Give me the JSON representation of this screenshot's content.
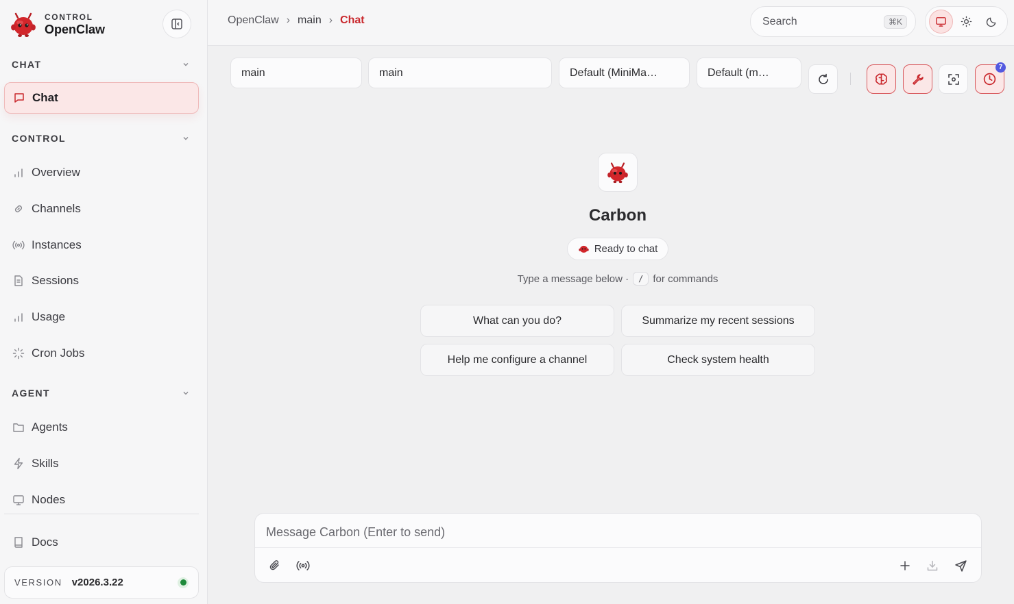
{
  "brand": {
    "eyebrow": "CONTROL",
    "name": "OpenClaw"
  },
  "sidebar": {
    "sections": [
      {
        "label": "CHAT",
        "items": [
          {
            "label": "Chat",
            "icon": "message-icon",
            "active": true
          }
        ]
      },
      {
        "label": "CONTROL",
        "items": [
          {
            "label": "Overview",
            "icon": "bar-chart-icon"
          },
          {
            "label": "Channels",
            "icon": "link-icon"
          },
          {
            "label": "Instances",
            "icon": "broadcast-icon"
          },
          {
            "label": "Sessions",
            "icon": "document-icon"
          },
          {
            "label": "Usage",
            "icon": "bar-chart-icon"
          },
          {
            "label": "Cron Jobs",
            "icon": "loader-icon"
          }
        ]
      },
      {
        "label": "AGENT",
        "items": [
          {
            "label": "Agents",
            "icon": "folder-icon"
          },
          {
            "label": "Skills",
            "icon": "lightning-icon"
          },
          {
            "label": "Nodes",
            "icon": "monitor-icon"
          }
        ]
      }
    ],
    "docs_label": "Docs",
    "version_key": "VERSION",
    "version_value": "v2026.3.22",
    "status_color": "#1f8a3b"
  },
  "breadcrumb": {
    "root": "OpenClaw",
    "middle": "main",
    "current": "Chat",
    "separator": "›"
  },
  "search": {
    "placeholder": "Search",
    "shortcut": "⌘K"
  },
  "theme": {
    "selected": "system",
    "options": [
      "monitor-icon",
      "sun-icon",
      "moon-icon"
    ]
  },
  "toolbar": {
    "selects": [
      "main",
      "main",
      "Default (MiniMa…",
      "Default (m…"
    ],
    "history_badge": "7"
  },
  "welcome": {
    "agent_name": "Carbon",
    "status": "Ready to chat",
    "hint_prefix": "Type a message below ·",
    "hint_key": "/",
    "hint_suffix": "for commands",
    "suggestions": [
      "What can you do?",
      "Summarize my recent sessions",
      "Help me configure a channel",
      "Check system health"
    ]
  },
  "composer": {
    "placeholder": "Message Carbon (Enter to send)"
  },
  "colors": {
    "accent": "#c9282d",
    "badge": "#5359e0"
  }
}
